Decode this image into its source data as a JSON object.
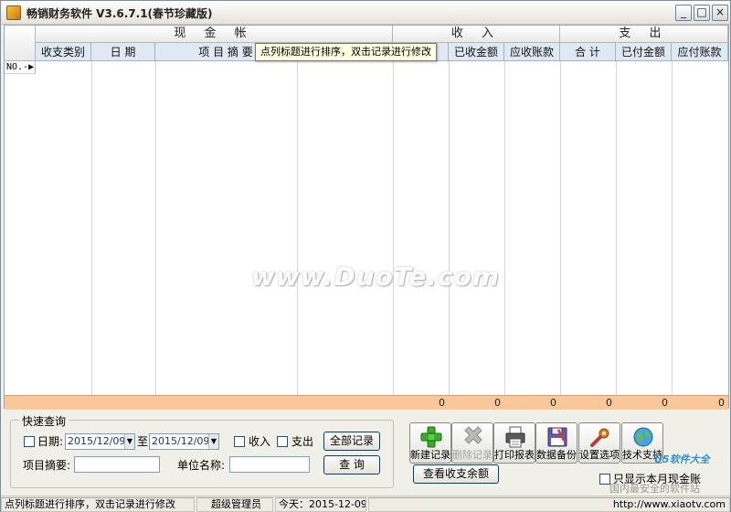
{
  "window": {
    "title": "畅销财务软件 V3.6.7.1(春节珍藏版)",
    "controls": {
      "minimize": "_",
      "restore": "□",
      "close": "×"
    }
  },
  "grid": {
    "group_headers": [
      {
        "key": "cash",
        "label": "现 金 帐"
      },
      {
        "key": "income",
        "label": "收 入"
      },
      {
        "key": "expense",
        "label": "支 出"
      }
    ],
    "columns": [
      {
        "label": "收支类别"
      },
      {
        "label": "日  期"
      },
      {
        "label": "项 目 摘 要"
      },
      {
        "label": ""
      },
      {
        "label": "合  计"
      },
      {
        "label": "已收金额"
      },
      {
        "label": "应收账款"
      },
      {
        "label": "合  计"
      },
      {
        "label": "已付金额"
      },
      {
        "label": "应付账款"
      }
    ],
    "row_marker": "NO.-▶",
    "totals": [
      "0",
      "0",
      "0",
      "0",
      "0",
      "0"
    ]
  },
  "tooltip": "点列标题进行排序，双击记录进行修改",
  "watermark": "www.DuoTe.com",
  "quick_query": {
    "legend": "快速查询",
    "date_label": "日期:",
    "date_from": "2015/12/09",
    "date_to": "2015/12/09",
    "to_label": "至",
    "income_label": "收入",
    "expense_label": "支出",
    "all_records_button": "全部记录",
    "summary_label": "项目摘要:",
    "unit_label": "单位名称:",
    "query_button": "查 询"
  },
  "toolbar": [
    {
      "key": "new",
      "label": "新建记录",
      "icon": "plus-icon",
      "enabled": true
    },
    {
      "key": "delete",
      "label": "删除记录",
      "icon": "delete-x-icon",
      "enabled": false
    },
    {
      "key": "print",
      "label": "打印报表",
      "icon": "printer-icon",
      "enabled": true
    },
    {
      "key": "backup",
      "label": "数据备份",
      "icon": "floppy-icon",
      "enabled": true
    },
    {
      "key": "settings",
      "label": "设置选项",
      "icon": "wrench-icon",
      "enabled": true
    },
    {
      "key": "support",
      "label": "技术支持",
      "icon": "globe-icon",
      "enabled": true
    }
  ],
  "balance_button": "查看收支余额",
  "month_only_label": "只显示本月现金账",
  "corner_logo": "U5软件大全",
  "corner_sub": "国内最安全的软件站",
  "statusbar": {
    "hint": "点列标题进行排序，双击记录进行修改",
    "user": "超级管理员",
    "today": "今天：2015-12-09",
    "site": "http://www.xiaotv.com"
  },
  "colors": {
    "accent_header": "#dfe9f3",
    "totals_row": "#f8c89a",
    "tooltip_bg": "#ffffe1"
  }
}
